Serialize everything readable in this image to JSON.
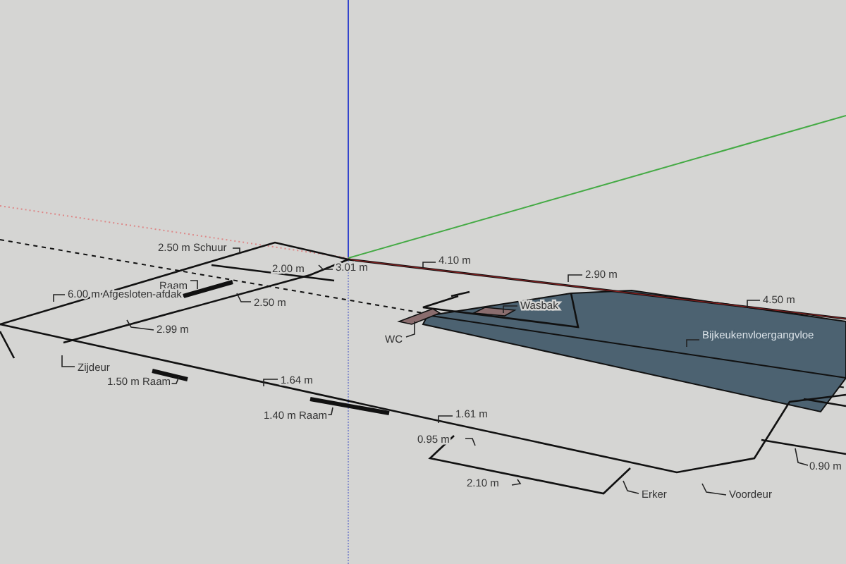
{
  "viewport": {
    "labels": [
      {
        "text": "2.50 m Schuur"
      },
      {
        "text": "2.00 m"
      },
      {
        "text": "3.01 m"
      },
      {
        "text": "Raam"
      },
      {
        "text": "6.00 m Afgesloten-afdak"
      },
      {
        "text": "2.50 m"
      },
      {
        "text": "2.99 m"
      },
      {
        "text": "Zijdeur"
      },
      {
        "text": "1.50 m Raam"
      },
      {
        "text": "1.64 m"
      },
      {
        "text": "1.40 m Raam"
      },
      {
        "text": "WC"
      },
      {
        "text": "4.10 m"
      },
      {
        "text": "2.90 m"
      },
      {
        "text": "Wasbak"
      },
      {
        "text": "4.50 m"
      },
      {
        "text": "Bijkeukenvloergangvloe"
      },
      {
        "text": "1.61 m"
      },
      {
        "text": "0.95 m"
      },
      {
        "text": "2.10 m"
      },
      {
        "text": "Erker"
      },
      {
        "text": "Voordeur"
      },
      {
        "text": "0.90 m"
      }
    ]
  }
}
